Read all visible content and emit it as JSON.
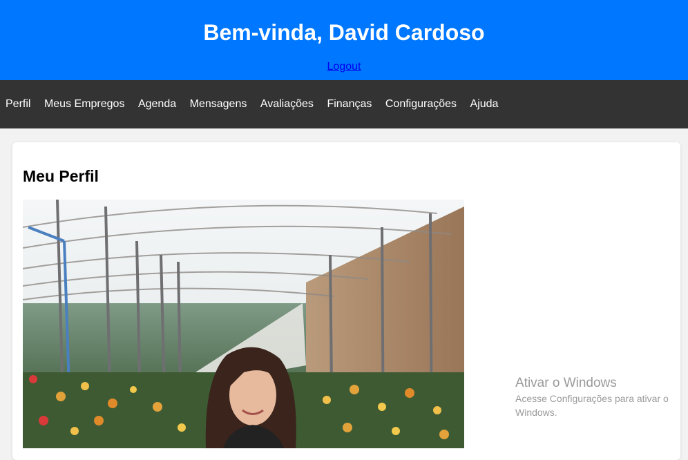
{
  "header": {
    "title": "Bem-vinda, David Cardoso",
    "logout_label": "Logout",
    "bg_color": "#0077ff"
  },
  "nav": {
    "items": [
      {
        "label": "Perfil"
      },
      {
        "label": "Meus Empregos"
      },
      {
        "label": "Agenda"
      },
      {
        "label": "Mensagens"
      },
      {
        "label": "Avaliações"
      },
      {
        "label": "Finanças"
      },
      {
        "label": "Configurações"
      },
      {
        "label": "Ajuda"
      }
    ],
    "bg_color": "#333333"
  },
  "profile": {
    "heading": "Meu Perfil"
  },
  "watermark": {
    "title": "Ativar o Windows",
    "subtitle": "Acesse Configurações para ativar o Windows."
  }
}
